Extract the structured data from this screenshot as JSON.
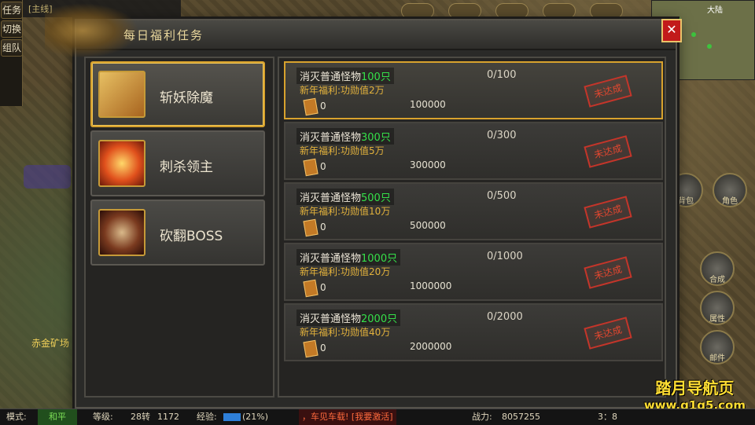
{
  "hud": {
    "quest_label": "[主线]",
    "side_tabs": [
      "任务",
      "切换",
      "组队"
    ],
    "minimap_title": "大陆",
    "left_area_label": "赤金矿场",
    "right_icons": [
      "背包",
      "角色",
      "合成",
      "邮件",
      "属性"
    ]
  },
  "dialog": {
    "title": "每日福利任务",
    "close_label": "✕"
  },
  "categories": [
    {
      "label": "斩妖除魔",
      "active": true,
      "icon": "scroll-icon"
    },
    {
      "label": "刺杀领主",
      "active": false,
      "icon": "phoenix-icon"
    },
    {
      "label": "砍翻BOSS",
      "active": false,
      "icon": "demon-skull-icon"
    }
  ],
  "tasks": [
    {
      "name_prefix": "消灭普通怪物",
      "name_count": "100只",
      "progress": "0/100",
      "reward": "新年福利:功勋值2万",
      "ticket_count": "0",
      "value": "100000",
      "status": "未达成",
      "active": true
    },
    {
      "name_prefix": "消灭普通怪物",
      "name_count": "300只",
      "progress": "0/300",
      "reward": "新年福利:功勋值5万",
      "ticket_count": "0",
      "value": "300000",
      "status": "未达成",
      "active": false
    },
    {
      "name_prefix": "消灭普通怪物",
      "name_count": "500只",
      "progress": "0/500",
      "reward": "新年福利:功勋值10万",
      "ticket_count": "0",
      "value": "500000",
      "status": "未达成",
      "active": false
    },
    {
      "name_prefix": "消灭普通怪物",
      "name_count": "1000只",
      "progress": "0/1000",
      "reward": "新年福利:功勋值20万",
      "ticket_count": "0",
      "value": "1000000",
      "status": "未达成",
      "active": false
    },
    {
      "name_prefix": "消灭普通怪物",
      "name_count": "2000只",
      "progress": "0/2000",
      "reward": "新年福利:功勋值40万",
      "ticket_count": "0",
      "value": "2000000",
      "status": "未达成",
      "active": false
    }
  ],
  "statusbar": {
    "mode_label": "模式:",
    "mode_value": "和平",
    "level_label": "等级:",
    "level_value": "28转",
    "level_extra": "1172",
    "exp_label": "经验:",
    "exp_percent": "(21%)",
    "broadcast": "，车见车载!  [我要激活]",
    "power_label": "战力:",
    "power_value": "8057255",
    "time": "3：8"
  },
  "watermark": {
    "title": "踏月导航页",
    "url": "www.q1q5.com"
  }
}
